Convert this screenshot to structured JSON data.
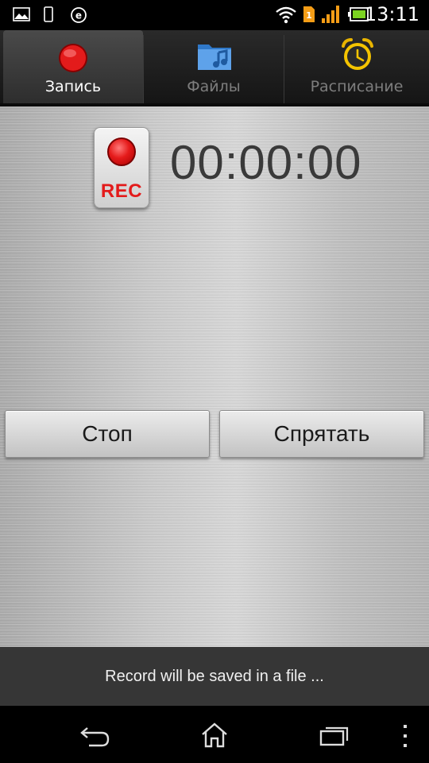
{
  "status_bar": {
    "time": "13:11",
    "sim_badge": "1",
    "icons": [
      "gallery-icon",
      "phone-icon",
      "e-circle-icon",
      "wifi-icon",
      "sim-icon",
      "signal-icon",
      "battery-icon"
    ]
  },
  "tabs": [
    {
      "label": "Запись",
      "icon": "record-dot-icon",
      "active": true
    },
    {
      "label": "Файлы",
      "icon": "music-folder-icon",
      "active": false
    },
    {
      "label": "Расписание",
      "icon": "alarm-clock-icon",
      "active": false
    }
  ],
  "recorder": {
    "rec_label": "REC",
    "timer": "00:00:00"
  },
  "buttons": {
    "stop_label": "Стоп",
    "hide_label": "Спрятать"
  },
  "info": {
    "message": "Record will be saved in a file ..."
  },
  "nav": {
    "icons": [
      "back-icon",
      "home-icon",
      "recent-apps-icon",
      "menu-dots-icon"
    ]
  },
  "colors": {
    "rec_red": "#e31b1b",
    "metal": "#bcbcbc",
    "tab_active": "#4a4a4a",
    "info_bar": "#363636"
  }
}
